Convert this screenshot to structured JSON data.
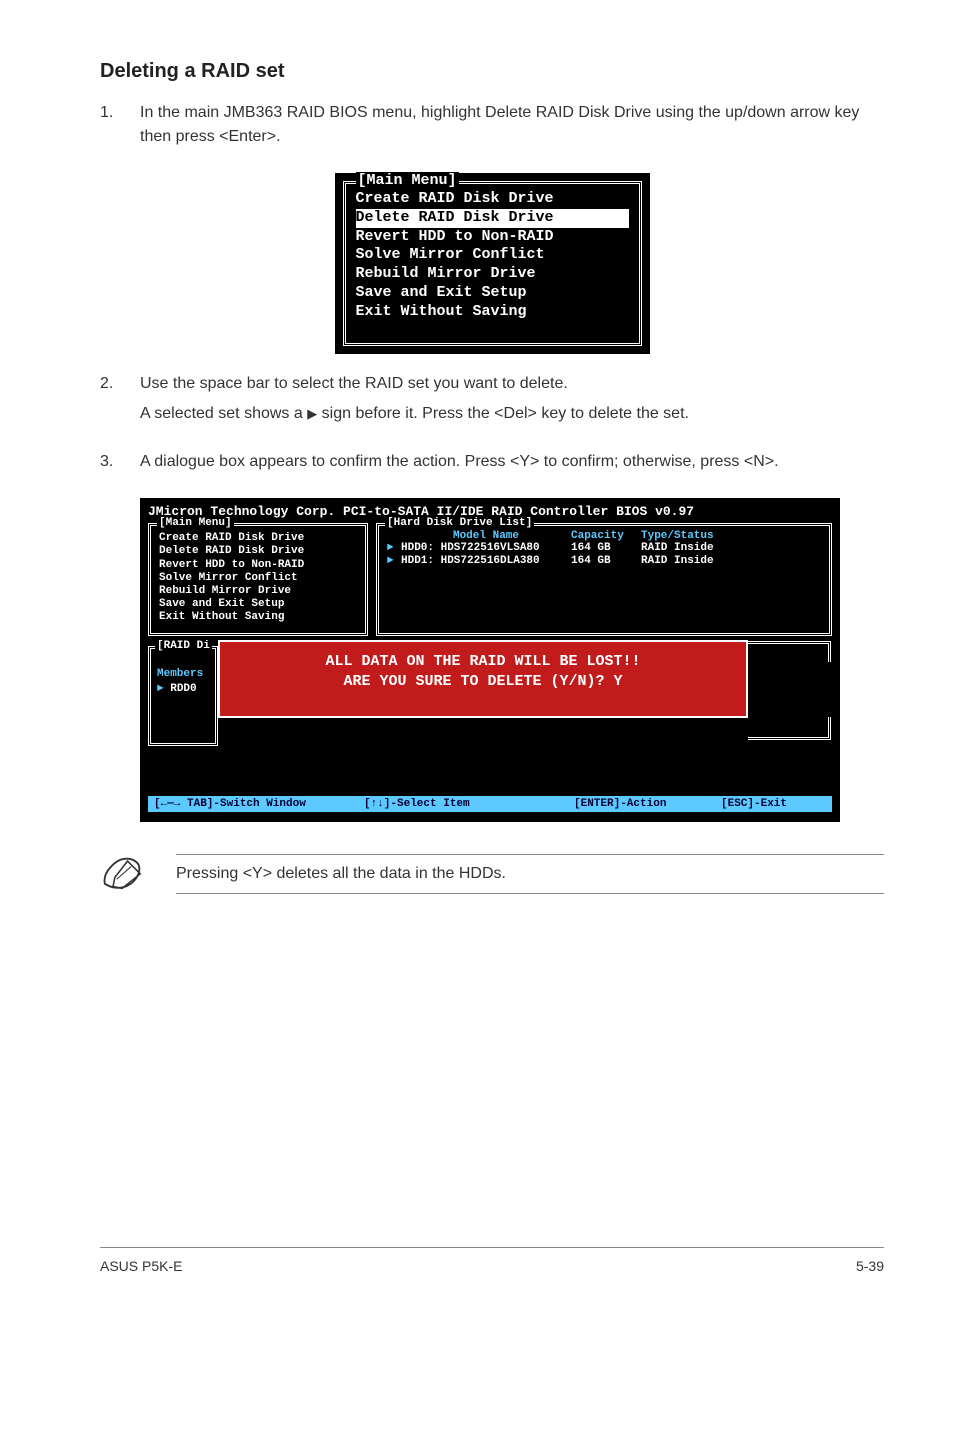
{
  "heading": "Deleting a RAID set",
  "steps": {
    "s1_num": "1.",
    "s1_text": "In the main JMB363 RAID BIOS menu, highlight Delete RAID Disk Drive using the up/down arrow key then press <Enter>.",
    "s2_num": "2.",
    "s2_text_a": "Use the space bar to select the RAID set you want to delete.",
    "s2_text_b_pre": "A selected set shows a ",
    "s2_text_b_post": " sign before it. Press the <Del> key to delete the set.",
    "s3_num": "3.",
    "s3_text": "A dialogue box appears to confirm the action. Press <Y> to confirm; otherwise, press <N>."
  },
  "mainmenu_small": {
    "title": "[Main Menu]",
    "lines": [
      "Create RAID Disk Drive",
      "Delete RAID Disk Drive",
      "Revert HDD to Non-RAID",
      "Solve Mirror Conflict",
      "Rebuild Mirror Drive",
      "Save and Exit Setup",
      "Exit Without Saving"
    ],
    "selected_index": 1
  },
  "bios": {
    "title": "JMicron Technology Corp. PCI-to-SATA II/IDE RAID Controller BIOS v0.97",
    "mainmenu_title": "[Main Menu]",
    "mainmenu_lines": [
      "Create RAID Disk Drive",
      "Delete RAID Disk Drive",
      "Revert HDD to Non-RAID",
      "Solve Mirror Conflict",
      "Rebuild Mirror Drive",
      "Save and Exit Setup",
      "Exit Without Saving"
    ],
    "hdd_title": "[Hard Disk Drive List]",
    "hdd_header": {
      "model": "Model Name",
      "capacity": "Capacity",
      "type": "Type/Status"
    },
    "hdd_rows": [
      {
        "arrow": "►",
        "name": "HDD0: HDS722516VLSA80",
        "cap": "164 GB",
        "type": "RAID Inside"
      },
      {
        "arrow": "►",
        "name": "HDD1: HDS722516DLA380",
        "cap": "164 GB",
        "type": "RAID Inside"
      }
    ],
    "raid_title": "[RAID Di",
    "raid_members": "Members",
    "raid_row": "RDD0",
    "overlay_l1": "ALL DATA ON THE RAID WILL BE LOST!!",
    "overlay_l2": "ARE YOU SURE TO DELETE (Y/N)? Y",
    "footer_tabs": "[←—→ TAB]-Switch Window",
    "footer_sel": "[↑↓]-Select Item",
    "footer_action": "[ENTER]-Action",
    "footer_esc": "[ESC]-Exit"
  },
  "note_text": "Pressing <Y> deletes all the data in the HDDs.",
  "footer_left": "ASUS P5K-E",
  "footer_right": "5-39"
}
